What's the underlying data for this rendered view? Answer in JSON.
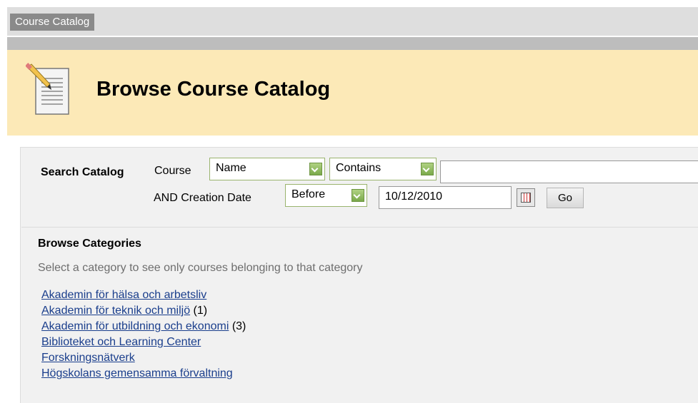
{
  "breadcrumb": {
    "label": "Course Catalog"
  },
  "page": {
    "title": "Browse Course Catalog",
    "icon": "document-pencil-icon"
  },
  "search": {
    "label": "Search Catalog",
    "field_label": "Course",
    "field_value": "Name",
    "operator_value": "Contains",
    "text_value": "",
    "date_label": "AND Creation Date",
    "date_operator_value": "Before",
    "date_value": "10/12/2010",
    "go_label": "Go"
  },
  "categories": {
    "title": "Browse Categories",
    "description": "Select a category to see only courses belonging to that category",
    "items": [
      {
        "name": "Akademin för hälsa och arbetsliv",
        "count": ""
      },
      {
        "name": "Akademin för teknik och miljö",
        "count": "(1)"
      },
      {
        "name": "Akademin för utbildning och ekonomi",
        "count": "(3)"
      },
      {
        "name": "Biblioteket och Learning Center",
        "count": ""
      },
      {
        "name": "Forskningsnätverk",
        "count": ""
      },
      {
        "name": "Högskolans gemensamma förvaltning",
        "count": ""
      }
    ]
  },
  "colors": {
    "banner": "#fce9b7",
    "link": "#1a3e8c",
    "dropdown_accent": "#7aa94a"
  }
}
